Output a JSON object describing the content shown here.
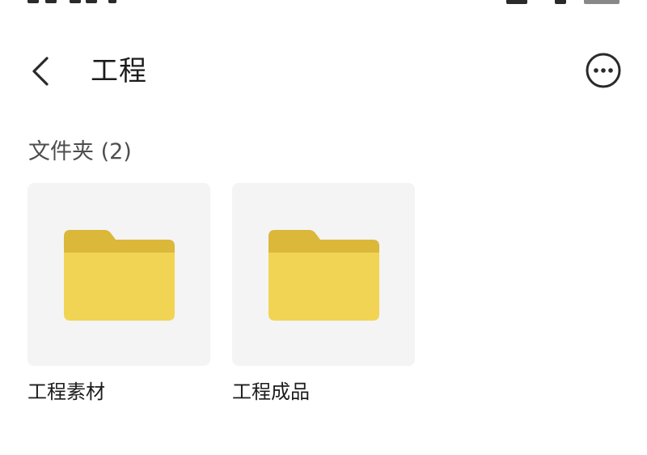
{
  "header": {
    "title": "工程",
    "back_icon": "chevron-left-icon",
    "more_icon": "more-horizontal-circle-icon"
  },
  "section": {
    "title": "文件夹 (2)"
  },
  "folders": [
    {
      "name": "工程素材",
      "icon": "folder-icon"
    },
    {
      "name": "工程成品",
      "icon": "folder-icon"
    }
  ],
  "colors": {
    "folder_front": "#F1D454",
    "folder_back": "#DBB73A",
    "card_background": "#F4F4F4",
    "text_primary": "#1C1C1C",
    "text_secondary": "#4D4D4D"
  }
}
